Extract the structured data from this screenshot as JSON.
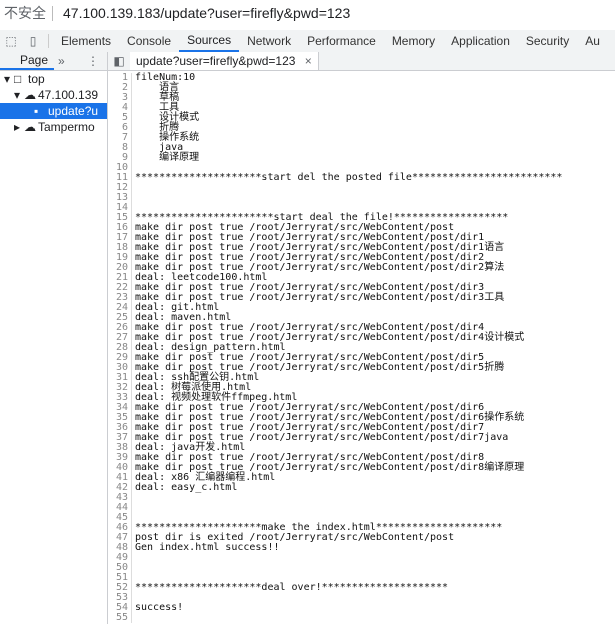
{
  "address_bar": {
    "security_label": "不安全",
    "url": "47.100.139.183/update?user=firefly&pwd=123"
  },
  "devtools_tabs": [
    "Elements",
    "Console",
    "Sources",
    "Network",
    "Performance",
    "Memory",
    "Application",
    "Security",
    "Au"
  ],
  "active_tab": "Sources",
  "navigator": {
    "tab_label": "Page",
    "more": "»",
    "menu": "⋮",
    "tree": [
      {
        "arrow": "▾",
        "icon": "□",
        "label": "top",
        "indent": 0
      },
      {
        "arrow": "▾",
        "icon": "☁",
        "label": "47.100.139",
        "indent": 1
      },
      {
        "arrow": "",
        "icon": "▪",
        "label": "update?u",
        "indent": 2,
        "selected": true
      },
      {
        "arrow": "▸",
        "icon": "☁",
        "label": "Tampermo",
        "indent": 1
      }
    ]
  },
  "editor": {
    "file_tab": "update?user=firefly&pwd=123",
    "close": "×",
    "lines": [
      "fileNum:10",
      "    语言",
      "    草稿",
      "    工具",
      "    设计模式",
      "    折腾",
      "    操作系统",
      "    java",
      "    编译原理",
      "",
      "*********************start del the posted file*************************",
      "",
      "",
      "",
      "***********************start deal the file!*******************",
      "make dir post true /root/Jerryrat/src/WebContent/post",
      "make dir post true /root/Jerryrat/src/WebContent/post/dir1",
      "make dir post true /root/Jerryrat/src/WebContent/post/dir1语言",
      "make dir post true /root/Jerryrat/src/WebContent/post/dir2",
      "make dir post true /root/Jerryrat/src/WebContent/post/dir2算法",
      "deal: leetcode100.html",
      "make dir post true /root/Jerryrat/src/WebContent/post/dir3",
      "make dir post true /root/Jerryrat/src/WebContent/post/dir3工具",
      "deal: git.html",
      "deal: maven.html",
      "make dir post true /root/Jerryrat/src/WebContent/post/dir4",
      "make dir post true /root/Jerryrat/src/WebContent/post/dir4设计模式",
      "deal: design_pattern.html",
      "make dir post true /root/Jerryrat/src/WebContent/post/dir5",
      "make dir post true /root/Jerryrat/src/WebContent/post/dir5折腾",
      "deal: ssh配置公钥.html",
      "deal: 树莓派使用.html",
      "deal: 视频处理软件ffmpeg.html",
      "make dir post true /root/Jerryrat/src/WebContent/post/dir6",
      "make dir post true /root/Jerryrat/src/WebContent/post/dir6操作系统",
      "make dir post true /root/Jerryrat/src/WebContent/post/dir7",
      "make dir post true /root/Jerryrat/src/WebContent/post/dir7java",
      "deal: java开发.html",
      "make dir post true /root/Jerryrat/src/WebContent/post/dir8",
      "make dir post true /root/Jerryrat/src/WebContent/post/dir8编译原理",
      "deal: x86 汇编器编程.html",
      "deal: easy_c.html",
      "",
      "",
      "",
      "*********************make the index.html*********************",
      "post dir is exited /root/Jerryrat/src/WebContent/post",
      "Gen index.html success!!",
      "",
      "",
      "",
      "*********************deal over!*********************",
      "",
      "success!",
      ""
    ]
  }
}
